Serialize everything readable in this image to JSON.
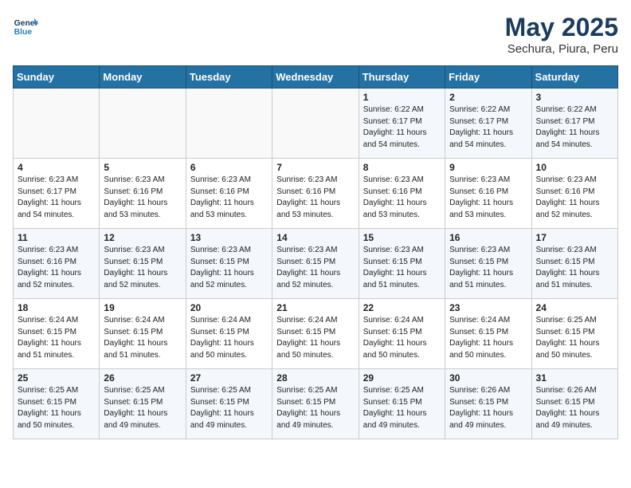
{
  "logo": {
    "line1": "General",
    "line2": "Blue"
  },
  "title": "May 2025",
  "subtitle": "Sechura, Piura, Peru",
  "days_of_week": [
    "Sunday",
    "Monday",
    "Tuesday",
    "Wednesday",
    "Thursday",
    "Friday",
    "Saturday"
  ],
  "weeks": [
    [
      {
        "day": "",
        "info": ""
      },
      {
        "day": "",
        "info": ""
      },
      {
        "day": "",
        "info": ""
      },
      {
        "day": "",
        "info": ""
      },
      {
        "day": "1",
        "info": "Sunrise: 6:22 AM\nSunset: 6:17 PM\nDaylight: 11 hours\nand 54 minutes."
      },
      {
        "day": "2",
        "info": "Sunrise: 6:22 AM\nSunset: 6:17 PM\nDaylight: 11 hours\nand 54 minutes."
      },
      {
        "day": "3",
        "info": "Sunrise: 6:22 AM\nSunset: 6:17 PM\nDaylight: 11 hours\nand 54 minutes."
      }
    ],
    [
      {
        "day": "4",
        "info": "Sunrise: 6:23 AM\nSunset: 6:17 PM\nDaylight: 11 hours\nand 54 minutes."
      },
      {
        "day": "5",
        "info": "Sunrise: 6:23 AM\nSunset: 6:16 PM\nDaylight: 11 hours\nand 53 minutes."
      },
      {
        "day": "6",
        "info": "Sunrise: 6:23 AM\nSunset: 6:16 PM\nDaylight: 11 hours\nand 53 minutes."
      },
      {
        "day": "7",
        "info": "Sunrise: 6:23 AM\nSunset: 6:16 PM\nDaylight: 11 hours\nand 53 minutes."
      },
      {
        "day": "8",
        "info": "Sunrise: 6:23 AM\nSunset: 6:16 PM\nDaylight: 11 hours\nand 53 minutes."
      },
      {
        "day": "9",
        "info": "Sunrise: 6:23 AM\nSunset: 6:16 PM\nDaylight: 11 hours\nand 53 minutes."
      },
      {
        "day": "10",
        "info": "Sunrise: 6:23 AM\nSunset: 6:16 PM\nDaylight: 11 hours\nand 52 minutes."
      }
    ],
    [
      {
        "day": "11",
        "info": "Sunrise: 6:23 AM\nSunset: 6:16 PM\nDaylight: 11 hours\nand 52 minutes."
      },
      {
        "day": "12",
        "info": "Sunrise: 6:23 AM\nSunset: 6:15 PM\nDaylight: 11 hours\nand 52 minutes."
      },
      {
        "day": "13",
        "info": "Sunrise: 6:23 AM\nSunset: 6:15 PM\nDaylight: 11 hours\nand 52 minutes."
      },
      {
        "day": "14",
        "info": "Sunrise: 6:23 AM\nSunset: 6:15 PM\nDaylight: 11 hours\nand 52 minutes."
      },
      {
        "day": "15",
        "info": "Sunrise: 6:23 AM\nSunset: 6:15 PM\nDaylight: 11 hours\nand 51 minutes."
      },
      {
        "day": "16",
        "info": "Sunrise: 6:23 AM\nSunset: 6:15 PM\nDaylight: 11 hours\nand 51 minutes."
      },
      {
        "day": "17",
        "info": "Sunrise: 6:23 AM\nSunset: 6:15 PM\nDaylight: 11 hours\nand 51 minutes."
      }
    ],
    [
      {
        "day": "18",
        "info": "Sunrise: 6:24 AM\nSunset: 6:15 PM\nDaylight: 11 hours\nand 51 minutes."
      },
      {
        "day": "19",
        "info": "Sunrise: 6:24 AM\nSunset: 6:15 PM\nDaylight: 11 hours\nand 51 minutes."
      },
      {
        "day": "20",
        "info": "Sunrise: 6:24 AM\nSunset: 6:15 PM\nDaylight: 11 hours\nand 50 minutes."
      },
      {
        "day": "21",
        "info": "Sunrise: 6:24 AM\nSunset: 6:15 PM\nDaylight: 11 hours\nand 50 minutes."
      },
      {
        "day": "22",
        "info": "Sunrise: 6:24 AM\nSunset: 6:15 PM\nDaylight: 11 hours\nand 50 minutes."
      },
      {
        "day": "23",
        "info": "Sunrise: 6:24 AM\nSunset: 6:15 PM\nDaylight: 11 hours\nand 50 minutes."
      },
      {
        "day": "24",
        "info": "Sunrise: 6:25 AM\nSunset: 6:15 PM\nDaylight: 11 hours\nand 50 minutes."
      }
    ],
    [
      {
        "day": "25",
        "info": "Sunrise: 6:25 AM\nSunset: 6:15 PM\nDaylight: 11 hours\nand 50 minutes."
      },
      {
        "day": "26",
        "info": "Sunrise: 6:25 AM\nSunset: 6:15 PM\nDaylight: 11 hours\nand 49 minutes."
      },
      {
        "day": "27",
        "info": "Sunrise: 6:25 AM\nSunset: 6:15 PM\nDaylight: 11 hours\nand 49 minutes."
      },
      {
        "day": "28",
        "info": "Sunrise: 6:25 AM\nSunset: 6:15 PM\nDaylight: 11 hours\nand 49 minutes."
      },
      {
        "day": "29",
        "info": "Sunrise: 6:25 AM\nSunset: 6:15 PM\nDaylight: 11 hours\nand 49 minutes."
      },
      {
        "day": "30",
        "info": "Sunrise: 6:26 AM\nSunset: 6:15 PM\nDaylight: 11 hours\nand 49 minutes."
      },
      {
        "day": "31",
        "info": "Sunrise: 6:26 AM\nSunset: 6:15 PM\nDaylight: 11 hours\nand 49 minutes."
      }
    ]
  ]
}
